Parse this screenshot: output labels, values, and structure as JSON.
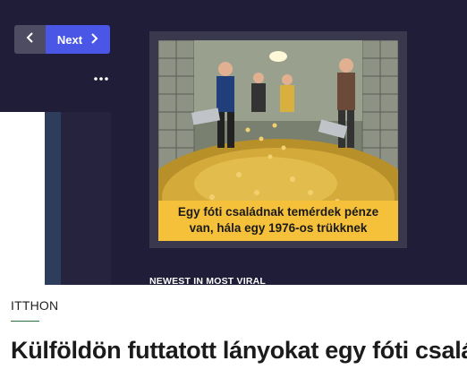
{
  "nav": {
    "prev_icon": "chevron-left-icon",
    "next_label": "Next",
    "next_icon": "chevron-right-icon",
    "more_icon": "more-dots-icon",
    "accent_color": "#4a57e6"
  },
  "ad": {
    "caption_line1": "Egy fóti családnak temérdek pénze",
    "caption_line2": "van, hála egy 1976-os trükknek",
    "caption_bg": "#f6c13a"
  },
  "section": {
    "label": "NEWEST IN MOST VIRAL"
  },
  "article": {
    "category": "ITTHON",
    "title": "Külföldön futtatott lányokat egy fóti család"
  }
}
